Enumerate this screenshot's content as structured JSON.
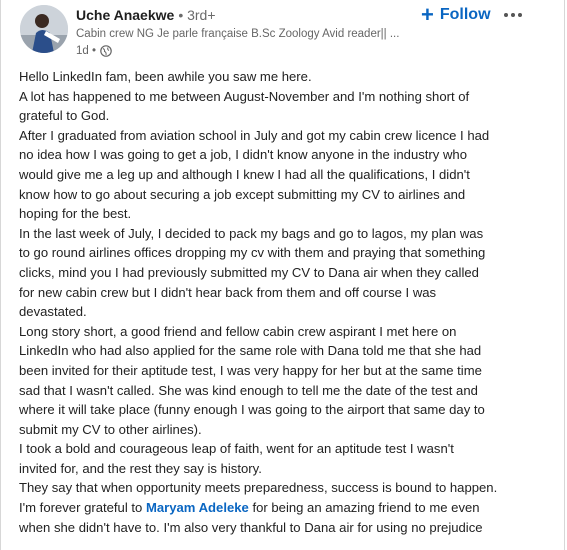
{
  "author": {
    "name": "Uche Anaekwe",
    "degree": "• 3rd+",
    "headline": "Cabin crew NG Je parle française B.Sc Zoology Avid reader|| ...",
    "time": "1d •"
  },
  "actions": {
    "follow_label": "Follow",
    "follow_icon": "plus-icon",
    "more_icon": "ellipsis-icon"
  },
  "post": {
    "lines": [
      "Hello LinkedIn fam, been awhile you saw me here.",
      "A lot has happened to me between August-November and I'm nothing short of",
      "grateful to God.",
      "After I graduated from aviation school in July and got my cabin crew licence I had",
      "no idea how I was going to get a job, I didn't know anyone in the industry who",
      "would give me a leg up and although I knew I had all the qualifications, I didn't",
      "know how to go about securing a job except submitting my CV to airlines and",
      "hoping for the best.",
      "In the last week of July, I decided to pack my bags and go to lagos, my plan was",
      "to go round airlines offices dropping my cv with them and praying that something",
      "clicks, mind you I had previously submitted my CV to Dana air when they called",
      "for new cabin crew but I didn't hear back from them and off course I was",
      "devastated.",
      "Long story short, a good friend and fellow cabin crew aspirant I met here on",
      "LinkedIn who had also applied for the same role with Dana told me that she had",
      "been invited for their aptitude test, I was very happy for her but at the same time",
      "sad that I wasn't called. She was kind enough to tell me the date of the test and",
      "where it will take place (funny enough I was going to the airport that same day to",
      "submit my CV to other airlines).",
      "I took a bold and courageous leap of faith, went for an aptitude test I wasn't",
      "invited for, and the rest they say is history.",
      "They say that when opportunity meets preparedness, success is bound to happen."
    ],
    "mention_prefix": "I'm forever grateful to ",
    "mention_name": "Maryam Adeleke",
    "mention_suffix": " for being an amazing friend to me even",
    "last_line": "when she didn't have to. I'm also very thankful to Dana air for using no prejudice"
  }
}
